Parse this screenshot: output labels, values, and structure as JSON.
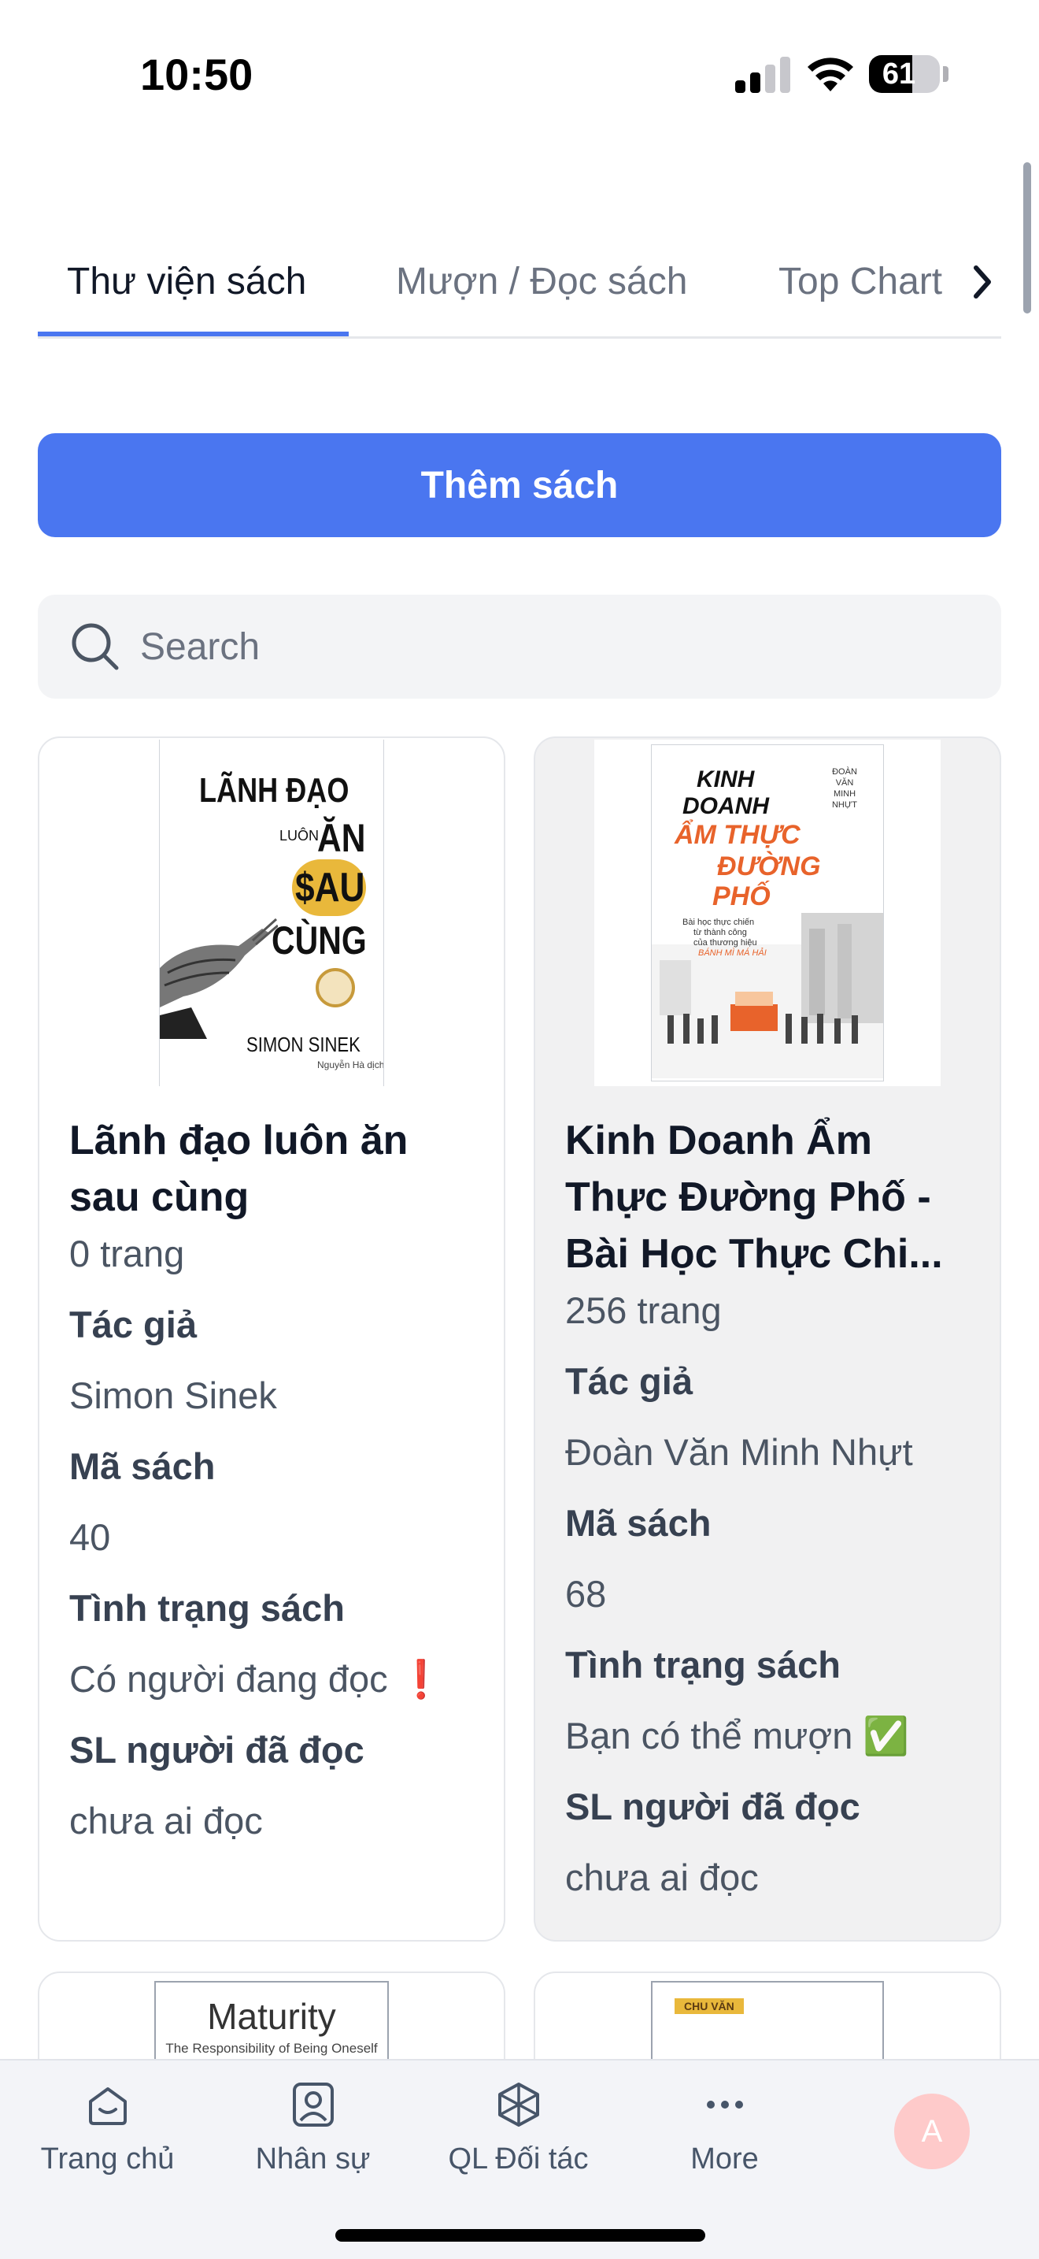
{
  "status_bar": {
    "time": "10:50",
    "battery": "61",
    "battery_level": 0.61
  },
  "tabs": [
    {
      "label": "Thư viện sách",
      "active": true
    },
    {
      "label": "Mượn / Đọc sách",
      "active": false
    },
    {
      "label": "Top Chart",
      "active": false
    }
  ],
  "actions": {
    "add_book": "Thêm sách"
  },
  "search": {
    "placeholder": "Search"
  },
  "field_labels": {
    "author": "Tác giả",
    "book_code": "Mã sách",
    "status": "Tình trạng sách",
    "readers": "SL người đã đọc"
  },
  "books": [
    {
      "title": "Lãnh đạo luôn ăn sau cùng",
      "pages": "0 trang",
      "author": "Simon Sinek",
      "code": "40",
      "status": "Có người đang đọc ❗",
      "readers": "chưa ai đọc",
      "cover": {
        "line1": "LÃNH ĐẠO",
        "line2_small": "LUÔN",
        "line2": "ĂN",
        "line3": "$AU",
        "line4": "CÙNG",
        "author": "SIMON SINEK",
        "translator": "Nguyễn Hà dịch"
      }
    },
    {
      "title": "Kinh Doanh Ẩm Thực Đường Phố - Bài Học Thực Chi...",
      "pages": "256 trang",
      "author": "Đoàn Văn Minh Nhựt",
      "code": "68",
      "status": "Bạn có thể mượn ✅",
      "readers": "chưa ai đọc",
      "cover": {
        "kinh": "KINH",
        "doanh": "DOANH",
        "am_thuc": "ẨM THỰC",
        "duong": "ĐƯỜNG",
        "pho": "PHỐ",
        "author_vertical": "ĐOÀN VĂN MINH NHỰT",
        "sub1": "Bài học thực chiến",
        "sub2": "từ thành công",
        "sub3": "của thương hiệu",
        "brand": "BÁNH MÌ MÁ HẢI"
      }
    },
    {
      "cover": {
        "title": "Maturity",
        "subtitle": "The Responsibility of Being Oneself"
      }
    },
    {
      "cover": {
        "tag": "CHU VĂN"
      }
    }
  ],
  "bottom_nav": [
    {
      "label": "Trang chủ",
      "icon": "home-icon"
    },
    {
      "label": "Nhân sự",
      "icon": "person-badge-icon"
    },
    {
      "label": "QL Đối tác",
      "icon": "partner-cube-icon"
    },
    {
      "label": "More",
      "icon": "more-dots-icon"
    }
  ],
  "avatar": {
    "initial": "A"
  },
  "colors": {
    "accent": "#4a76f0",
    "card_border": "#e5e7eb",
    "card_alt_bg": "#f1f1f2",
    "nav_bg": "#f3f4f8",
    "avatar_bg": "#fecaca",
    "cover_orange": "#e8632b",
    "cover_gold": "#e9b83b"
  }
}
